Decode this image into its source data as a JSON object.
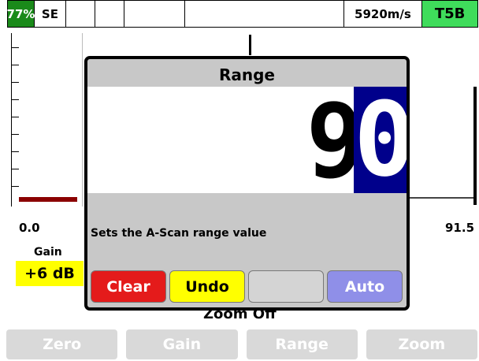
{
  "status_bar": {
    "battery": "77%",
    "mode": "SE",
    "velocity": "5920m/s",
    "probe": "T5B"
  },
  "plot": {
    "axis_start": "0.0",
    "axis_end": "91.5"
  },
  "gain": {
    "label": "Gain",
    "value": "+6 dB"
  },
  "zoom_status": "Zoom Off",
  "softkeys": [
    "Zero",
    "Gain",
    "Range",
    "Zoom"
  ],
  "dialog": {
    "title": "Range",
    "digits": [
      "9",
      "0"
    ],
    "help": "Sets the A-Scan range value",
    "buttons": {
      "clear": "Clear",
      "undo": "Undo",
      "blank": "",
      "auto": "Auto"
    }
  },
  "colors": {
    "battery_bg": "#1a8a1a",
    "probe_bg": "#3fdc5b",
    "gain_bg": "#ffff00",
    "echo": "#8b0000",
    "active_digit_bg": "#00008b",
    "clear_btn": "#e41b1b",
    "undo_btn": "#ffff00",
    "auto_btn": "#8f8fe8"
  }
}
